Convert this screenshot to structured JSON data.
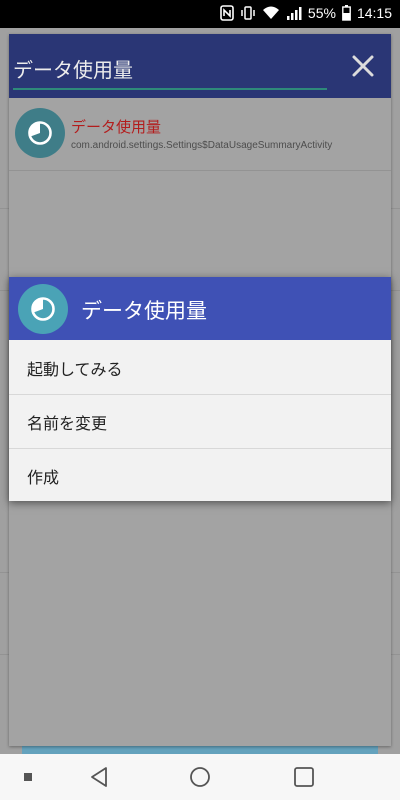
{
  "status_bar": {
    "battery": "55%",
    "time": "14:15",
    "icons": [
      "nfc-icon",
      "vibrate-icon",
      "wifi-icon",
      "signal-icon",
      "battery-icon"
    ]
  },
  "search": {
    "query": "データ使用量",
    "close_icon": "close-icon"
  },
  "result": {
    "title": "データ使用量",
    "package": "com.android.settings.Settings$DataUsageSummaryActivity",
    "icon": "data-usage-icon"
  },
  "dialog": {
    "title": "データ使用量",
    "icon": "data-usage-icon",
    "items": [
      {
        "label": "起動してみる"
      },
      {
        "label": "名前を変更"
      },
      {
        "label": "作成"
      }
    ]
  },
  "nav_bar": {
    "icons": [
      "recent-dot-icon",
      "back-icon",
      "home-icon",
      "overview-icon"
    ]
  },
  "colors": {
    "search_header": "#2a3675",
    "dialog_header": "#3f51b5",
    "result_title": "#b31d1d",
    "icon_teal": "#4aa3b6"
  }
}
